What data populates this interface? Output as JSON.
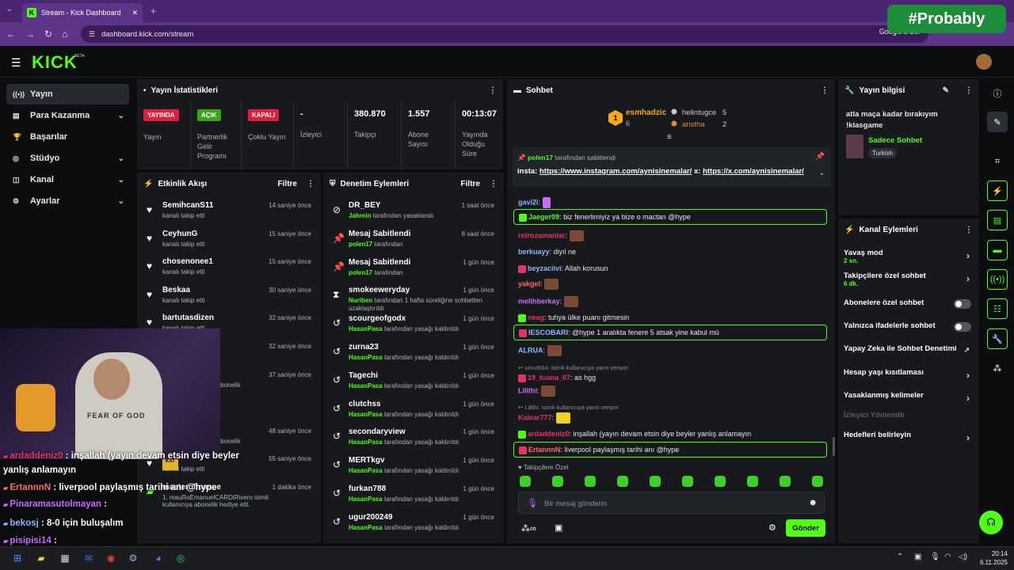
{
  "browser": {
    "tab_title": "Stream - Kick Dashboard",
    "url": "dashboard.kick.com/stream",
    "google_btn": "Google'a Sor",
    "watermark": "#Probably"
  },
  "logo": "KICK",
  "beta": "BETA",
  "sidebar": [
    {
      "label": "Yayın",
      "icon": "live-icon"
    },
    {
      "label": "Para Kazanma",
      "icon": "money-icon"
    },
    {
      "label": "Başarılar",
      "icon": "trophy-icon"
    },
    {
      "label": "Stüdyo",
      "icon": "studio-icon"
    },
    {
      "label": "Kanal",
      "icon": "channel-icon"
    },
    {
      "label": "Ayarlar",
      "icon": "gear-icon"
    }
  ],
  "stats": {
    "title": "Yayın İstatistikleri",
    "items": [
      {
        "pill": "YAYINDA",
        "pill_color": "#e01e3c",
        "label": "Yayın"
      },
      {
        "pill": "AÇIK",
        "pill_color": "#3aa316",
        "label": "Partnerlik Gelir Programı"
      },
      {
        "pill": "KAPALI",
        "pill_color": "#e01e3c",
        "label": "Çoklu Yayın"
      },
      {
        "value": "-",
        "label": "İzleyici"
      },
      {
        "value": "380.870",
        "label": "Takipçi"
      },
      {
        "value": "1.557",
        "label": "Abone Sayısı"
      },
      {
        "value": "00:13:07",
        "label": "Yayında Olduğu Süre"
      }
    ]
  },
  "activity": {
    "title": "Etkinlik Akışı",
    "filter": "Filtre",
    "items": [
      {
        "name": "SemihcanS11",
        "sub": "kanalı takip etti",
        "time": "14 saniye önce"
      },
      {
        "name": "CeyhunG",
        "sub": "kanalı takip etti",
        "time": "15 saniye önce"
      },
      {
        "name": "chosenonee1",
        "sub": "kanalı takip etti",
        "time": "15 saniye önce"
      },
      {
        "name": "Beskaa",
        "sub": "kanalı takip etti",
        "time": "30 saniye önce"
      },
      {
        "name": "bartutasdizen",
        "sub": "kanalı takip etti",
        "time": "32 saniye önce"
      },
      {
        "name": "",
        "sub": "",
        "time": "32 saniye önce"
      },
      {
        "name": "",
        "sub": "ni kutluyor! Toplam abonelik",
        "time": "37 saniye önce"
      },
      {
        "name": "",
        "sub": "luluyorsun",
        "time": ""
      },
      {
        "name": "",
        "sub": "ni kutluyor! Toplam abonelik",
        "time": "48 saniye önce"
      },
      {
        "name": "",
        "sub": "kanalı takip etti",
        "time": "55 saniye önce"
      },
      {
        "name": "masterofinance",
        "sub": "1, mauRoEmanuelCARDiRivero isimli kullanıcıya abonelik hediye etti.",
        "time": "1 dakika önce"
      }
    ]
  },
  "mod": {
    "title": "Denetim Eylemleri",
    "filter": "Filtre",
    "items": [
      {
        "name": "DR_BEY",
        "user": "Jahrein",
        "sub": "tarafından yasaklandı",
        "time": "1 saat önce",
        "icon": "ban-icon"
      },
      {
        "name": "Mesaj Sabitlendi",
        "user": "polen17",
        "sub": "tarafından",
        "time": "8 saat önce",
        "icon": "pin-icon"
      },
      {
        "name": "Mesaj Sabitlendi",
        "user": "polen17",
        "sub": "tarafından",
        "time": "1 gün önce",
        "icon": "pin-icon"
      },
      {
        "name": "smokeeweryday",
        "user": "Nuriben",
        "sub": "tarafından 1 hafta süreliğine sohbetten uzaklaştırıldı",
        "time": "1 gün önce",
        "icon": "hourglass-icon"
      },
      {
        "name": "scourgeofgodx",
        "user": "HasanPasa",
        "sub": "tarafından yasağı kaldırıldı",
        "time": "1 gün önce",
        "icon": "undo-icon"
      },
      {
        "name": "zurna23",
        "user": "HasanPasa",
        "sub": "tarafından yasağı kaldırıldı",
        "time": "1 gün önce",
        "icon": "undo-icon"
      },
      {
        "name": "Tagechi",
        "user": "HasanPasa",
        "sub": "tarafından yasağı kaldırıldı",
        "time": "1 gün önce",
        "icon": "undo-icon"
      },
      {
        "name": "clutchss",
        "user": "HasanPasa",
        "sub": "tarafından yasağı kaldırıldı",
        "time": "1 gün önce",
        "icon": "undo-icon"
      },
      {
        "name": "secondaryview",
        "user": "HasanPasa",
        "sub": "tarafından yasağı kaldırıldı",
        "time": "1 gün önce",
        "icon": "undo-icon"
      },
      {
        "name": "MERTkgv",
        "user": "HasanPasa",
        "sub": "tarafından yasağı kaldırıldı",
        "time": "1 gün önce",
        "icon": "undo-icon"
      },
      {
        "name": "furkan788",
        "user": "HasanPasa",
        "sub": "tarafından yasağı kaldırıldı",
        "time": "1 gün önce",
        "icon": "undo-icon"
      },
      {
        "name": "ugur200249",
        "user": "HasanPasa",
        "sub": "tarafından yasağı kaldırıldı",
        "time": "1 gün önce",
        "icon": "undo-icon"
      }
    ]
  },
  "chat": {
    "title": "Sohbet",
    "leaders": [
      {
        "name": "esmhadzic",
        "count": "6"
      },
      {
        "name": "helintugce",
        "count": "5"
      },
      {
        "name": "aristha",
        "count": "2"
      }
    ],
    "pinned": {
      "user": "polen17",
      "by": "tarafından sabitlendi",
      "text": "insta: ",
      "link1": "https://www.instagram.com/aynisinemalar/",
      "mid": " x: ",
      "link2": "https://x.com/aynisinemalar/"
    },
    "messages": [
      {
        "user": "gavi2i",
        "color": "#8bb6ff",
        "text": "",
        "hl": false
      },
      {
        "user": "Jaeger09",
        "color": "#53fc18",
        "text": "biz fenerlimiyiz ya bize o mactan @hype",
        "hl": true
      },
      {
        "user": "retrozamanlar",
        "color": "#e0356a",
        "text": "",
        "hl": false
      },
      {
        "user": "berkuayy",
        "color": "#8bb6ff",
        "text": "diyıl ne",
        "hl": false
      },
      {
        "user": "beyzaciivi",
        "color": "#8bb6ff",
        "text": "Allah korusun",
        "hl": false
      },
      {
        "user": "yakgel",
        "color": "#ff6a6a",
        "text": "",
        "hl": false
      },
      {
        "user": "melihberkay",
        "color": "#c86cff",
        "text": "",
        "hl": false
      },
      {
        "user": "neag",
        "color": "#e0356a",
        "text": "tuhya ülke puanı gitmesin",
        "hl": false
      },
      {
        "user": "IESCOBARI",
        "color": "#8bb6ff",
        "text": "@hype 1 aralıkta fenere 5 atsak yine kabul mü",
        "hl": true
      },
      {
        "user": "ALRUA",
        "color": "#8bb6ff",
        "text": "",
        "hl": false
      },
      {
        "user": "19_tuana_07",
        "color": "#e0356a",
        "text": "as hgg",
        "hl": false,
        "reply": "umut564:",
        "reply_sub": "isimli kullanıcıya yanıt veriyor"
      },
      {
        "user": "Lilithi",
        "color": "#c86cff",
        "text": "",
        "hl": false
      },
      {
        "user": "Kalear777",
        "color": "#e0356a",
        "text": "",
        "hl": false,
        "reply": "Lilithi:",
        "reply_sub": "isimli kullanıcıya yanıt veriyor"
      },
      {
        "user": "ardaddeniz0",
        "color": "#e0356a",
        "text": "inşallah (yayın devam etsin diye beyler yanlış anlamayın",
        "hl": false
      },
      {
        "user": "ErtannnN",
        "color": "#ff6a6a",
        "text": "liverpool paylaşmış tarihi anı @hype",
        "hl": true
      }
    ],
    "followers_only": "Takipçilere Özel",
    "input_placeholder": "Bir mesaj gönderin",
    "send": "Gönder"
  },
  "info": {
    "title": "Yayın bilgisi",
    "stream_title": "atla maça kadar bırakıyım !klasgame",
    "category": "Sadece Sohbet",
    "tag": "Turkish"
  },
  "channel": {
    "title": "Kanal Eylemleri",
    "items": [
      {
        "label": "Yavaş mod",
        "sub": "2 sn.",
        "type": "arrow"
      },
      {
        "label": "Takipçilere özel sohbet",
        "sub": "6 dk.",
        "type": "arrow"
      },
      {
        "label": "Abonelere özel sohbet",
        "sub": "",
        "type": "toggle"
      },
      {
        "label": "Yalnızca ifadelerle sohbet",
        "sub": "",
        "type": "toggle"
      },
      {
        "label": "Yapay Zeka ile Sohbet Denetimi",
        "sub": "",
        "type": "ext"
      },
      {
        "label": "Hesap yaşı kısıtlaması",
        "sub": "",
        "type": "arrow"
      },
      {
        "label": "Yasaklanmış kelimeler",
        "sub": "",
        "type": "arrow"
      },
      {
        "label": "İzleyici Yönlendir",
        "sub": "",
        "type": "disabled"
      },
      {
        "label": "Hedefleri belirleyin",
        "sub": "",
        "type": "arrow"
      }
    ]
  },
  "overlay": {
    "lines": [
      {
        "user": "ardaddeniz0",
        "text": " : inşallah (yayın devam etsin diye beyler",
        "color": "#e0356a"
      },
      {
        "user": "",
        "text": "yanlış anlamayın",
        "color": "#fff"
      },
      {
        "user": "ErtannnN",
        "text": " : liverpool paylaşmış tarihi anı @hype",
        "color": "#ff6a6a"
      },
      {
        "user": "Pinaramasutolmayan",
        "text": " :",
        "color": "#c86cff"
      },
      {
        "user": "bekosj",
        "text": " : 8-0 için buluşalım",
        "color": "#8bb6ff"
      },
      {
        "user": "pisipisi14",
        "text": " :",
        "color": "#c86cff"
      }
    ]
  },
  "taskbar": {
    "time": "20:14",
    "date": "6.11.2025"
  }
}
